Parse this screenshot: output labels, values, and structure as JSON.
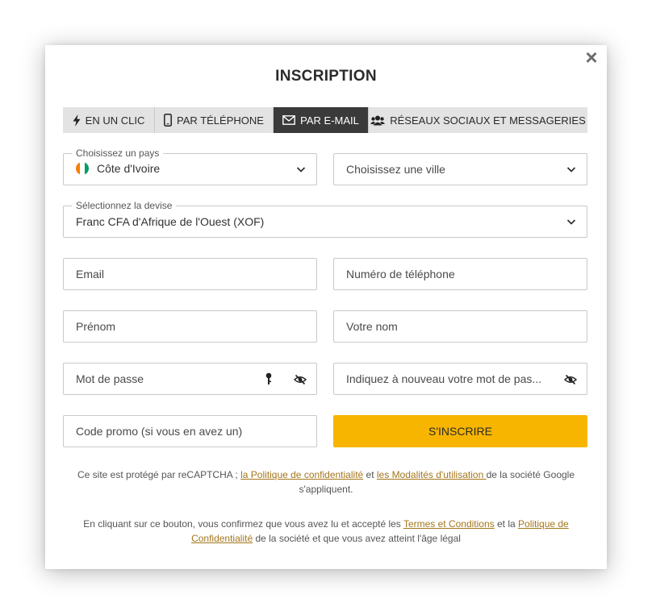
{
  "modal": {
    "title": "INSCRIPTION",
    "close_label": "×"
  },
  "tabs": [
    {
      "label": "EN UN CLIC",
      "icon": "lightning-icon",
      "active": false
    },
    {
      "label": "PAR TÉLÉPHONE",
      "icon": "phone-icon",
      "active": false
    },
    {
      "label": "PAR E-MAIL",
      "icon": "envelope-icon",
      "active": true
    },
    {
      "label": "RÉSEAUX SOCIAUX ET MESSAGERIES",
      "icon": "users-icon",
      "active": false
    }
  ],
  "form": {
    "country": {
      "legend": "Choisissez un pays",
      "value": "Côte d'Ivoire",
      "flag_colors": [
        "#f77f00",
        "#ffffff",
        "#009e60"
      ]
    },
    "city": {
      "placeholder": "Choisissez une ville"
    },
    "currency": {
      "legend": "Sélectionnez la devise",
      "value": "Franc CFA d'Afrique de l'Ouest (XOF)"
    },
    "email": {
      "placeholder": "Email"
    },
    "phone": {
      "placeholder": "Numéro de téléphone"
    },
    "first_name": {
      "placeholder": "Prénom"
    },
    "last_name": {
      "placeholder": "Votre nom"
    },
    "password": {
      "placeholder": "Mot de passe"
    },
    "password_confirm": {
      "placeholder": "Indiquez à nouveau votre mot de pas..."
    },
    "promo": {
      "placeholder": "Code promo (si vous en avez un)"
    },
    "submit_label": "S'INSCRIRE"
  },
  "recaptcha_note": {
    "prefix": "Ce site est protégé par reCAPTCHA ; ",
    "privacy_link": "la Politique de confidentialité",
    "middle": " et ",
    "terms_link": "les Modalités d'utilisation ",
    "suffix": "de la société Google s'appliquent."
  },
  "consent_note": {
    "prefix": "En cliquant sur ce bouton, vous confirmez que vous avez lu et accepté les ",
    "terms_link": "Termes et Conditions",
    "middle": " et la ",
    "privacy_link": "Politique de Confidentialité",
    "suffix": " de la société et que vous avez atteint l'âge légal"
  },
  "colors": {
    "accent": "#f7b500",
    "active_tab": "#3a3a3a",
    "link": "#a4761b"
  }
}
